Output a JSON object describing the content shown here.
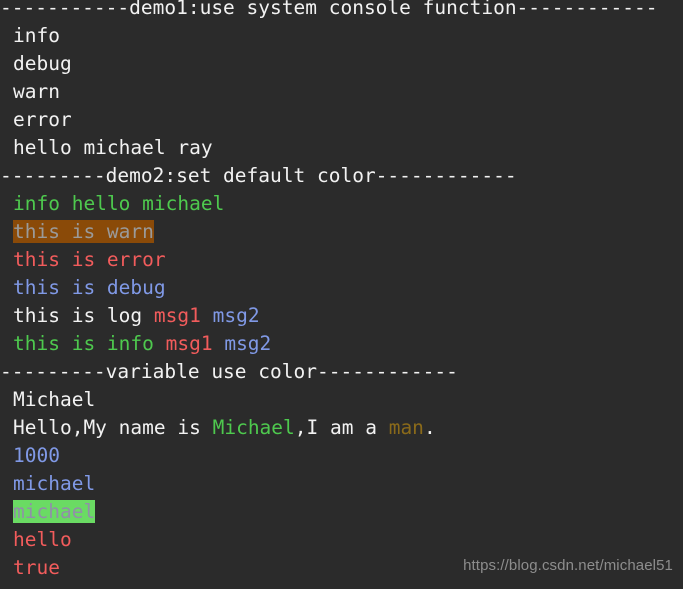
{
  "terminal": {
    "background_color": "#2b2b2b",
    "default_text_color": "#f2f2f2",
    "palette": {
      "white": "#f2f2f2",
      "green": "#4ec94e",
      "red": "#f25c5c",
      "blue": "#8099e6",
      "olive": "#8a6a1a",
      "gray": "#a8a8a8",
      "warn_background": "#8a4a08",
      "highlight_background": "#6adb63"
    }
  },
  "lines": [
    {
      "name": "section-header-demo1",
      "segments": [
        {
          "text": "-----------demo1:use system console function------------",
          "color": "white"
        }
      ]
    },
    {
      "name": "output-info",
      "segments": [
        {
          "text": "info",
          "color": "white"
        }
      ]
    },
    {
      "name": "output-debug",
      "segments": [
        {
          "text": "debug",
          "color": "white"
        }
      ]
    },
    {
      "name": "output-warn",
      "segments": [
        {
          "text": "warn",
          "color": "white"
        }
      ]
    },
    {
      "name": "output-error",
      "segments": [
        {
          "text": "error",
          "color": "white"
        }
      ]
    },
    {
      "name": "output-hello-michael-ray",
      "segments": [
        {
          "text": "hello michael ray",
          "color": "white"
        }
      ]
    },
    {
      "name": "section-header-demo2",
      "segments": [
        {
          "text": "---------demo2:set default color------------",
          "color": "white"
        }
      ]
    },
    {
      "name": "output-info-hello-michael",
      "segments": [
        {
          "text": "info hello michael",
          "color": "green"
        }
      ]
    },
    {
      "name": "output-this-is-warn",
      "segments": [
        {
          "text": "this is warn",
          "style": "warn-highlight"
        }
      ]
    },
    {
      "name": "output-this-is-error",
      "segments": [
        {
          "text": "this is error",
          "color": "red"
        }
      ]
    },
    {
      "name": "output-this-is-debug",
      "segments": [
        {
          "text": "this is debug",
          "color": "blue"
        }
      ]
    },
    {
      "name": "output-this-is-log",
      "segments": [
        {
          "text": "this is log ",
          "color": "white"
        },
        {
          "text": "msg1 ",
          "color": "red"
        },
        {
          "text": "msg2",
          "color": "blue"
        }
      ]
    },
    {
      "name": "output-this-is-info",
      "segments": [
        {
          "text": "this is info ",
          "color": "green"
        },
        {
          "text": "msg1 ",
          "color": "red"
        },
        {
          "text": "msg2",
          "color": "blue"
        }
      ]
    },
    {
      "name": "section-header-variable",
      "segments": [
        {
          "text": "---------variable use color------------",
          "color": "white"
        }
      ]
    },
    {
      "name": "output-michael-capital",
      "segments": [
        {
          "text": "Michael",
          "color": "white"
        }
      ]
    },
    {
      "name": "output-hello-my-name-is",
      "segments": [
        {
          "text": "Hello,My name is ",
          "color": "white"
        },
        {
          "text": "Michael",
          "color": "green"
        },
        {
          "text": ",I am a ",
          "color": "white"
        },
        {
          "text": "man",
          "color": "olive"
        },
        {
          "text": ".",
          "color": "white"
        }
      ]
    },
    {
      "name": "output-1000",
      "segments": [
        {
          "text": "1000",
          "color": "blue"
        }
      ]
    },
    {
      "name": "output-michael-blue",
      "segments": [
        {
          "text": "michael",
          "color": "blue"
        }
      ]
    },
    {
      "name": "output-michael-highlighted",
      "segments": [
        {
          "text": "michael",
          "style": "green-highlight"
        }
      ]
    },
    {
      "name": "output-hello-red",
      "segments": [
        {
          "text": "hello",
          "color": "red"
        }
      ]
    },
    {
      "name": "output-true",
      "segments": [
        {
          "text": "true",
          "color": "red"
        }
      ]
    }
  ],
  "watermark": {
    "text": "https://blog.csdn.net/michael51"
  }
}
